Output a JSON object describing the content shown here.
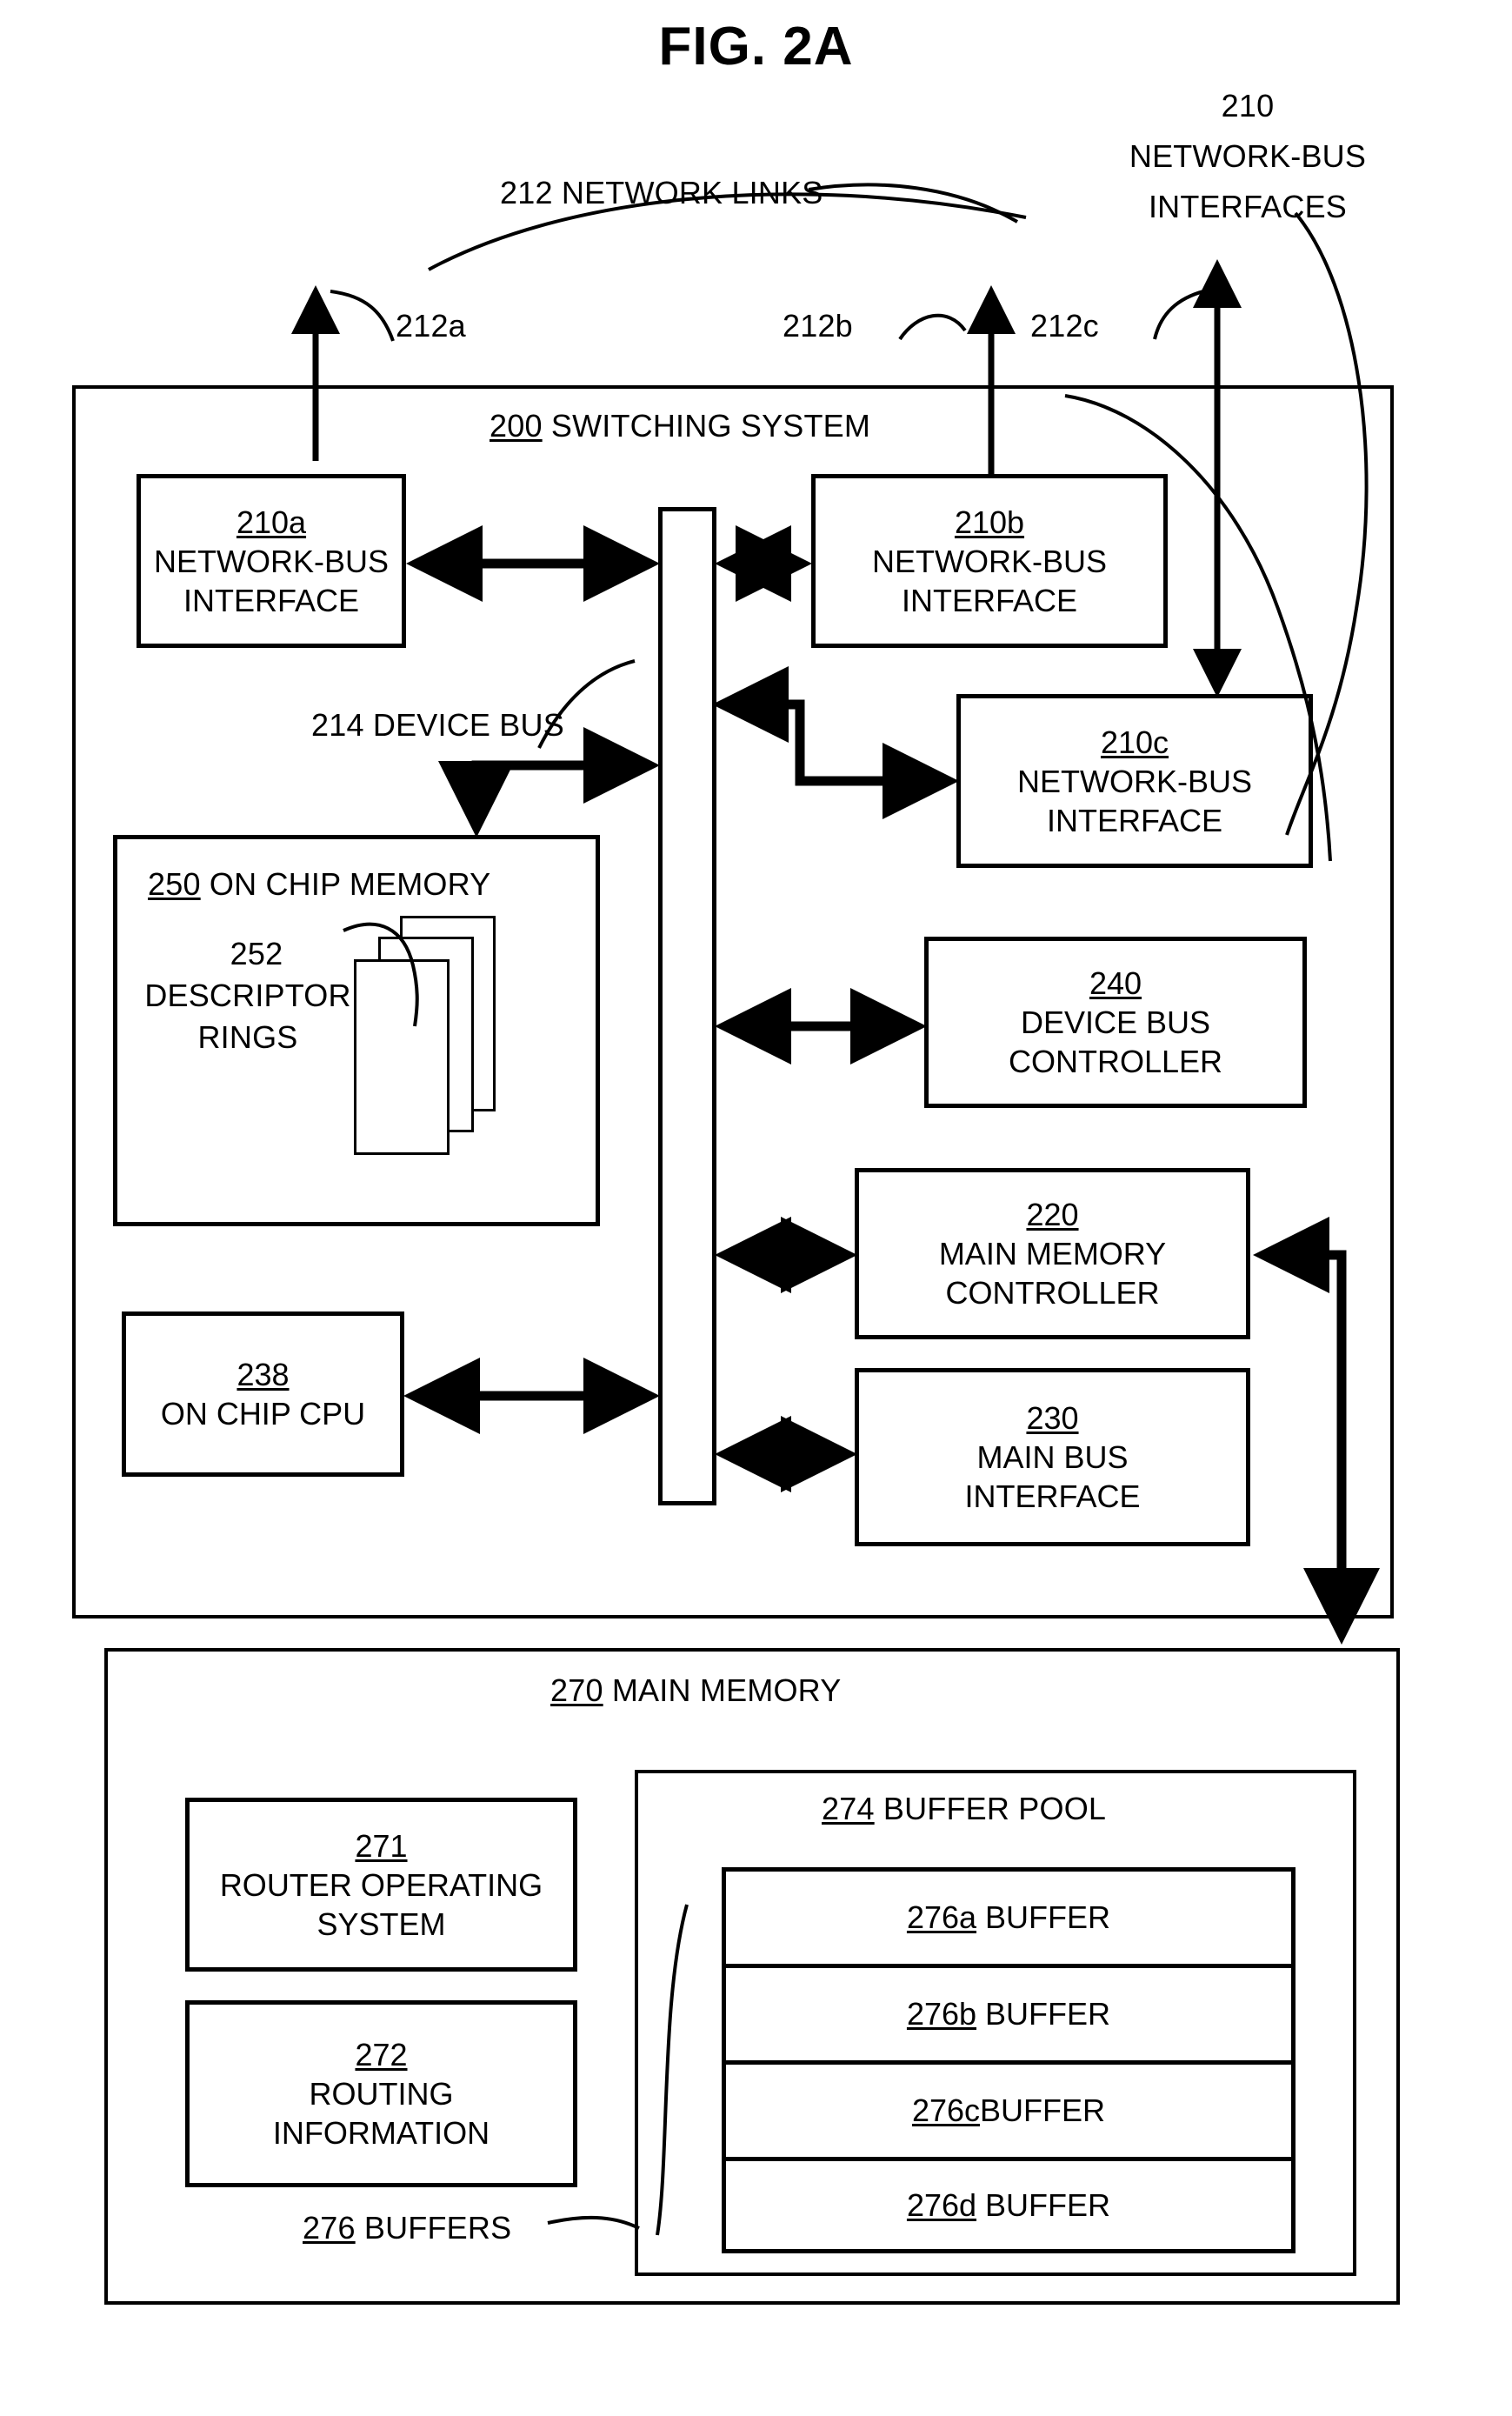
{
  "figure": {
    "title": "FIG. 2A"
  },
  "annotations": {
    "network_links": "212 NETWORK LINKS",
    "nbi_group_num": "210",
    "nbi_group_line1": "NETWORK-BUS",
    "nbi_group_line2": "INTERFACES",
    "link_a": "212a",
    "link_b": "212b",
    "link_c": "212c",
    "device_bus": "214 DEVICE BUS",
    "buffers_label_num": "276",
    "buffers_label_text": " BUFFERS"
  },
  "switching_system": {
    "num": "200",
    "title": " SWITCHING SYSTEM",
    "blocks": {
      "nbi_a": {
        "num": "210a",
        "line1": "NETWORK-BUS",
        "line2": "INTERFACE"
      },
      "nbi_b": {
        "num": "210b",
        "line1": "NETWORK-BUS",
        "line2": "INTERFACE"
      },
      "nbi_c": {
        "num": "210c",
        "line1": "NETWORK-BUS",
        "line2": "INTERFACE"
      },
      "on_chip_memory": {
        "num": "250",
        "title": " ON CHIP MEMORY",
        "rings_num": "252",
        "rings_line1": "DESCRIPTOR",
        "rings_line2": "RINGS",
        "ring_count": 3
      },
      "device_bus_controller": {
        "num": "240",
        "line1": "DEVICE BUS",
        "line2": "CONTROLLER"
      },
      "main_memory_controller": {
        "num": "220",
        "line1": "MAIN MEMORY",
        "line2": "CONTROLLER"
      },
      "on_chip_cpu": {
        "num": "238",
        "line1": "ON CHIP CPU"
      },
      "main_bus_interface": {
        "num": "230",
        "line1": "MAIN BUS",
        "line2": "INTERFACE"
      }
    }
  },
  "main_memory": {
    "num": "270",
    "title": " MAIN MEMORY",
    "router_os": {
      "num": "271",
      "line1": "ROUTER OPERATING",
      "line2": "SYSTEM"
    },
    "routing_info": {
      "num": "272",
      "line1": "ROUTING",
      "line2": "INFORMATION"
    },
    "buffer_pool": {
      "num": "274",
      "title": " BUFFER POOL",
      "buffers": [
        {
          "num": "276a",
          "label": " BUFFER"
        },
        {
          "num": "276b",
          "label": " BUFFER"
        },
        {
          "num": "276c",
          "label": "BUFFER"
        },
        {
          "num": "276d",
          "label": " BUFFER"
        }
      ]
    }
  },
  "colors": {
    "ink": "#000000",
    "paper": "#ffffff"
  }
}
